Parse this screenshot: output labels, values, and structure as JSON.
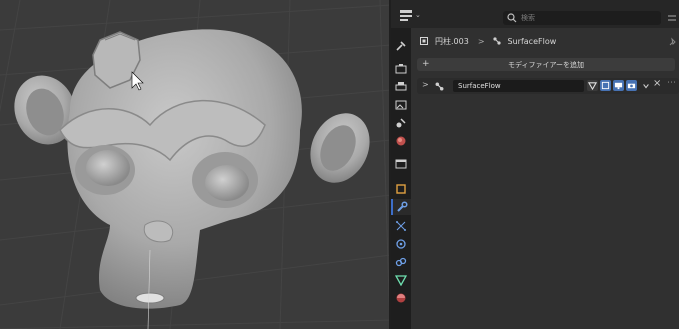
{
  "search": {
    "placeholder": "検索"
  },
  "breadcrumb": {
    "object_name": "円柱.003",
    "separator": ">",
    "modifier_name": "SurfaceFlow"
  },
  "add_modifier": {
    "label": "モディファイアーを追加",
    "plus": "+"
  },
  "modifier": {
    "expand_glyph": ">",
    "name": "SurfaceFlow",
    "close_glyph": "×",
    "more_glyph": "⋯"
  },
  "colors": {
    "accent": "#4772b3",
    "viewport_bg": "#3b3b3b",
    "panel_bg": "#303030"
  }
}
